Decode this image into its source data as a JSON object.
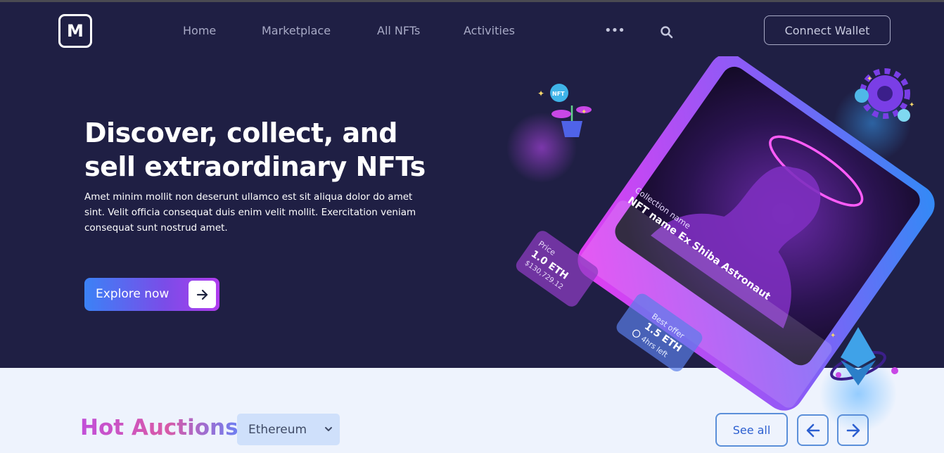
{
  "brand": {
    "logo_letter": "M"
  },
  "nav": {
    "items": [
      "Home",
      "Marketplace",
      "All NFTs",
      "Activities"
    ],
    "more_icon": "more-horizontal-icon",
    "search_icon": "search-icon",
    "connect_label": "Connect Wallet"
  },
  "hero": {
    "headline_line1": "Discover, collect, and",
    "headline_line2": "sell extraordinary NFTs",
    "subtext": "Amet minim mollit non deserunt ullamco est sit aliqua dolor do amet sint. Velit officia consequat duis enim velit mollit. Exercitation veniam consequat sunt nostrud amet.",
    "cta_label": "Explore now",
    "cta_icon": "arrow-right-icon"
  },
  "nft_card": {
    "collection_label": "Collection name",
    "nft_name": "NFT name Ex Shiba Astronaut",
    "price_label": "Price",
    "price_eth": "1.0 ETH",
    "price_usd": "$130,729.12",
    "offer_label": "Best offer",
    "offer_eth": "1.5 ETH",
    "time_left": "4hrs left",
    "plant_badge": "NFT"
  },
  "auctions": {
    "title": "Hot Auctions",
    "chain_selected": "Ethereum",
    "see_all_label": "See all",
    "prev_icon": "arrow-left-icon",
    "next_icon": "arrow-right-icon"
  },
  "colors": {
    "hero_bg": "#1f1f44",
    "page_bg": "#eef3fd",
    "accent_blue": "#3b82f6",
    "accent_purple": "#b13cee",
    "button_border": "#5b8fd9"
  }
}
